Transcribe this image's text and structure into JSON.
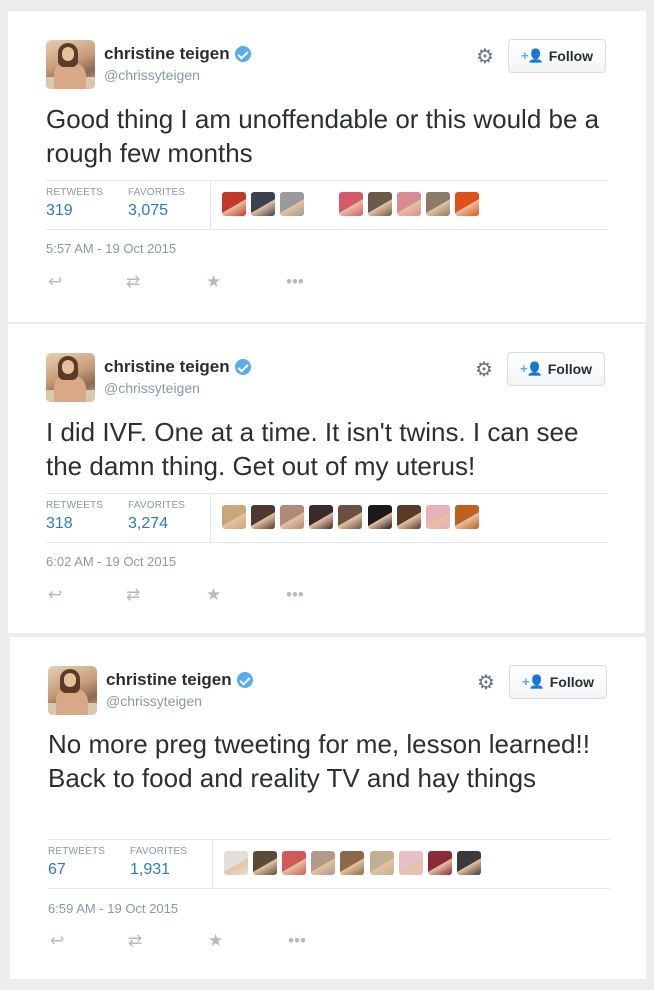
{
  "colors": {
    "background": "#ececec",
    "card": "#ffffff",
    "link_blue": "#2b7bb9",
    "verified_blue": "#55acee",
    "muted_text": "#8899a6",
    "action_icon": "#b1bbc3"
  },
  "icons": {
    "verified": "verified-badge-icon",
    "gear": "gear-icon",
    "follow": "follow-person-plus-icon",
    "reply": "reply-icon",
    "retweet": "retweet-icon",
    "favorite": "star-icon",
    "more": "more-dots-icon"
  },
  "follow_icon_glyph": "+👤",
  "tweets": [
    {
      "name": "christine teigen",
      "handle": "@chrissyteigen",
      "follow_label": "Follow",
      "text": "Good thing I am unoffendable or this would be a rough few months",
      "retweets_label": "RETWEETS",
      "retweets": "319",
      "favorites_label": "FAVORITES",
      "favorites": "3,075",
      "timestamp": "5:57 AM - 19 Oct 2015",
      "favoriter_avatar_colors": [
        "#c0392b",
        "#3a4150",
        "#9a9a9a",
        "#d45a6a",
        "#6a5a4a",
        "#d98a94",
        "#8a7a6a",
        "#e0501a"
      ]
    },
    {
      "name": "christine teigen",
      "handle": "@chrissyteigen",
      "follow_label": "Follow",
      "text": "I did IVF. One at a time. It isn't twins. I can see the damn thing. Get out of my uterus!",
      "retweets_label": "RETWEETS",
      "retweets": "318",
      "favorites_label": "FAVORITES",
      "favorites": "3,274",
      "timestamp": "6:02 AM - 19 Oct 2015",
      "favoriter_avatar_colors": [
        "#c8a878",
        "#4a3a30",
        "#b08a7a",
        "#3a2a2a",
        "#6a5040",
        "#1a1a1a",
        "#5a3a2a",
        "#e8b0b8",
        "#c06020"
      ]
    },
    {
      "name": "christine teigen",
      "handle": "@chrissyteigen",
      "follow_label": "Follow",
      "text": "No more preg tweeting for me, lesson learned!! Back to food and reality TV and hay things",
      "retweets_label": "RETWEETS",
      "retweets": "67",
      "favorites_label": "FAVORITES",
      "favorites": "1,931",
      "timestamp": "6:59 AM - 19 Oct 2015",
      "favoriter_avatar_colors": [
        "#e0e0d8",
        "#5a4a3a",
        "#d05a5a",
        "#b09a8a",
        "#8a6a4a",
        "#c0b090",
        "#e8c0c8",
        "#8a2a3a",
        "#3a3a3a"
      ]
    }
  ]
}
